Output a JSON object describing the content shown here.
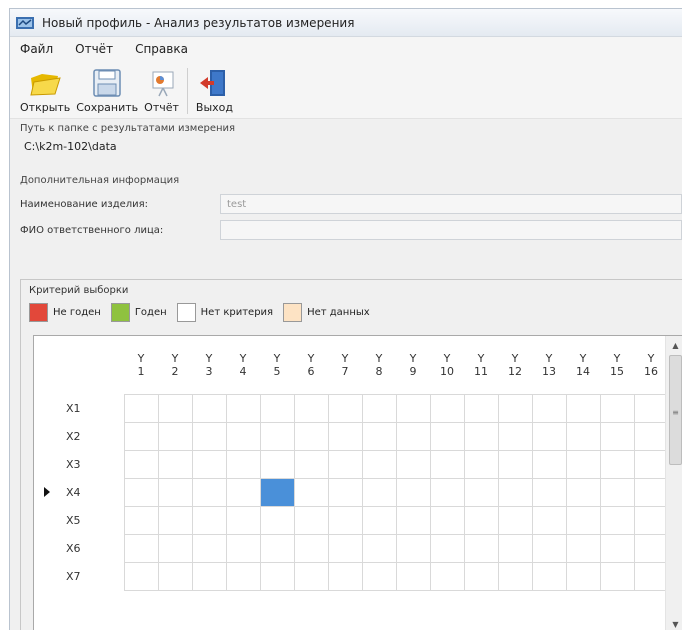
{
  "window": {
    "title": "Новый профиль - Анализ результатов измерения"
  },
  "menu": [
    "Файл",
    "Отчёт",
    "Справка"
  ],
  "toolbar": {
    "open_label": "Открыть",
    "save_label": "Сохранить",
    "report_label": "Отчёт",
    "exit_label": "Выход"
  },
  "path": {
    "label": "Путь к папке с результатами измерения",
    "value": "C:\\k2m-102\\data"
  },
  "info": {
    "heading": "Дополнительная информация",
    "product_label": "Наименование изделия:",
    "product_value": "test",
    "person_label": "ФИО ответственного лица:",
    "person_value": ""
  },
  "criteria": {
    "heading": "Критерий выборки",
    "legend": [
      {
        "label": "Не годен",
        "color": "#e2483a"
      },
      {
        "label": "Годен",
        "color": "#8fc23f"
      },
      {
        "label": "Нет критерия",
        "color": "#ffffff"
      },
      {
        "label": "Нет данных",
        "color": "#fde3c4"
      }
    ]
  },
  "grid": {
    "column_prefix": "Y",
    "columns": [
      "1",
      "2",
      "3",
      "4",
      "5",
      "6",
      "7",
      "8",
      "9",
      "10",
      "11",
      "12",
      "13",
      "14",
      "15",
      "16"
    ],
    "rows": [
      "X1",
      "X2",
      "X3",
      "X4",
      "X5",
      "X6",
      "X7"
    ],
    "current_row": "X4",
    "selected_cell": {
      "row": "X4",
      "column": "5"
    },
    "selected_color": "#4a90d9"
  }
}
